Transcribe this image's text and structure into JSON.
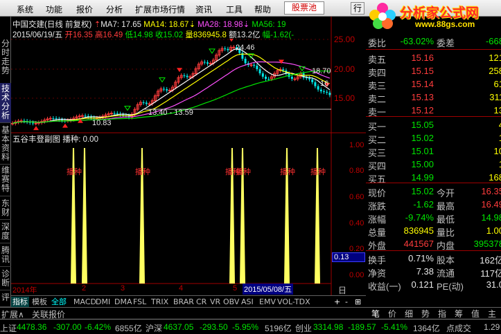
{
  "menu": {
    "items": [
      "系统",
      "功能",
      "报价",
      "分析",
      "扩展市场行情",
      "资讯",
      "工具",
      "帮助"
    ],
    "stock_pool": "股票池",
    "right_btn": "行"
  },
  "watermark": {
    "title": "分析家公式网",
    "url": "www.88gs.com"
  },
  "left_tabs": [
    "分时走势",
    "技术分析",
    "基本资料",
    "维赛特",
    "东财",
    "深度",
    "腾讯",
    "诊断",
    "评"
  ],
  "chart": {
    "title_line": "中国交建(日线 前复权)",
    "ma7": "MA7: 17.65",
    "ma14": "MA14: 18.67",
    "ma28": "MA28: 18.98",
    "ma56": "MA56: 19",
    "date": "2015/06/19/五",
    "open": "开16.35",
    "high": "高16.49",
    "low": "低14.98",
    "close": "收15.02",
    "volume": "量836945.8",
    "amount": "额13.2亿",
    "change": "幅-1.62(-"
  },
  "chart_data": {
    "type": "line",
    "price_axis": [
      "25.00",
      "20.00",
      "15.00"
    ],
    "annotations": [
      "24.46",
      "18.70",
      "16",
      "13.40 - 13.59",
      "10.83"
    ],
    "indicator_title": "五谷丰登副图",
    "indicator_name": "播种",
    "indicator_value": "0.00",
    "indicator_axis": [
      "1.00",
      "0.80",
      "0.60",
      "0.40",
      "0.20",
      "0.00"
    ],
    "cursor_value": "0.13",
    "signal_label": "播种",
    "x_labels": [
      "2014年",
      "2",
      "3",
      "4",
      "5"
    ],
    "cursor_date": "2015/05/08/五",
    "period": "日线"
  },
  "indicator_bar": [
    "指标",
    "模板",
    "全部",
    "MACD",
    "DMI",
    "DMA",
    "FSL",
    "TRIX",
    "BRAR",
    "CR",
    "VR",
    "OBV",
    "ASI",
    "EMV",
    "VOL-TDX"
  ],
  "zoom_buttons": [
    "+",
    "-",
    "⊞"
  ],
  "bottom_tabs": [
    "扩展∧",
    "关联报价"
  ],
  "quote_tabs": [
    "笔",
    "价",
    "细",
    "势",
    "指",
    "筹",
    "值",
    "主"
  ],
  "quote": {
    "weibi_label": "委比",
    "weibi": "-63.02%",
    "weicha_label": "委差",
    "weicha": "-668",
    "sell": [
      {
        "label": "卖五",
        "price": "15.16",
        "vol": "121"
      },
      {
        "label": "卖四",
        "price": "15.15",
        "vol": "258"
      },
      {
        "label": "卖三",
        "price": "15.14",
        "vol": "61"
      },
      {
        "label": "卖二",
        "price": "15.13",
        "vol": "311"
      },
      {
        "label": "卖一",
        "price": "15.12",
        "vol": "13"
      }
    ],
    "buy": [
      {
        "label": "买一",
        "price": "15.05",
        "vol": "4"
      },
      {
        "label": "买二",
        "price": "15.02",
        "vol": "1"
      },
      {
        "label": "买三",
        "price": "15.01",
        "vol": "10"
      },
      {
        "label": "买四",
        "price": "15.00",
        "vol": "1"
      },
      {
        "label": "买五",
        "price": "14.99",
        "vol": "168"
      }
    ],
    "stats": [
      {
        "l1": "现价",
        "v1": "15.02",
        "c1": "green",
        "l2": "今开",
        "v2": "16.35",
        "c2": "red"
      },
      {
        "l1": "涨跌",
        "v1": "-1.62",
        "c1": "green",
        "l2": "最高",
        "v2": "16.49",
        "c2": "red"
      },
      {
        "l1": "涨幅",
        "v1": "-9.74%",
        "c1": "green",
        "l2": "最低",
        "v2": "14.98",
        "c2": "green"
      },
      {
        "l1": "总量",
        "v1": "836945",
        "c1": "yellow",
        "l2": "量比",
        "v2": "1.00",
        "c2": "yellow"
      },
      {
        "l1": "外盘",
        "v1": "441567",
        "c1": "red",
        "l2": "内盘",
        "v2": "395378",
        "c2": "green"
      }
    ],
    "stats2": [
      {
        "l1": "换手",
        "v1": "0.71%",
        "l2": "股本",
        "v2": "162亿"
      },
      {
        "l1": "净资",
        "v1": "7.38",
        "l2": "流通",
        "v2": "117亿"
      },
      {
        "l1": "收益(一)",
        "v1": "0.121",
        "l2": "PE(动)",
        "v2": "31.0"
      }
    ]
  },
  "status": {
    "sh_label": "上证",
    "sh_val": "4478.36",
    "sh_chg": "-307.00",
    "sh_pct": "-6.42%",
    "sh_amt": "6855亿",
    "hs_label": "沪深",
    "hs_val": "4637.05",
    "hs_chg": "-293.50",
    "hs_pct": "-5.95%",
    "hs_amt": "5196亿",
    "cy_label": "创业",
    "cy_val": "3314.98",
    "cy_chg": "-189.57",
    "cy_pct": "-5.41%",
    "cy_amt": "1364亿",
    "deal_label": "点成交",
    "deal_val": "1.29"
  },
  "colors": {
    "up": "#ff3c3c",
    "down": "#00e600",
    "bar": "#ffff60",
    "signal": "#ff3030"
  }
}
